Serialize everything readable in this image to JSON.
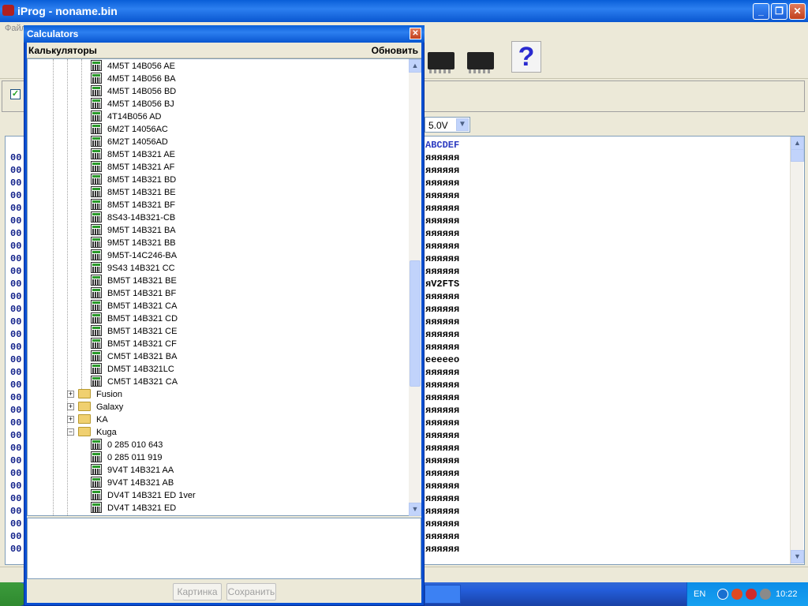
{
  "app": {
    "title": "iProg - noname.bin",
    "menu_first": "Файл",
    "voltage": "5.0V",
    "hex_header": "ABCDEF",
    "hex_addr_prefix": "00",
    "ascii_rows": [
      "яяяяяя",
      "яяяяяя",
      "яяяяяя",
      "яяяяяя",
      "яяяяяя",
      "яяяяяя",
      "яяяяяя",
      "яяяяяя",
      "яяяяяя",
      "яяяяяя",
      "яV2FTS",
      "яяяяяя",
      "яяяяяя",
      "яяяяяя",
      "яяяяяя",
      "яяяяяя",
      "eeeeeo",
      "яяяяяя",
      "яяяяяя",
      "яяяяяя",
      "яяяяяя",
      "яяяяяя",
      "яяяяяя",
      "яяяяяя",
      "яяяяяя",
      "яяяяяя",
      "яяяяяя",
      "яяяяяя",
      "яяяяяя",
      "яяяяяя",
      "яяяяяя",
      "яяяяяя"
    ]
  },
  "dialog": {
    "title": "Calculators",
    "header_left": "Калькуляторы",
    "header_right": "Обновить",
    "calc_items": [
      "4M5T 14B056 AE",
      "4M5T 14B056 BA",
      "4M5T 14B056 BD",
      "4M5T 14B056 BJ",
      "4T14B056 AD",
      "6M2T 14056AC",
      "6M2T 14056AD",
      "8M5T 14B321 AE",
      "8M5T 14B321 AF",
      "8M5T 14B321 BD",
      "8M5T 14B321 BE",
      "8M5T 14B321 BF",
      "8S43-14B321-CB",
      "9M5T 14B321 BA",
      "9M5T 14B321 BB",
      "9M5T-14C246-BA",
      "9S43 14B321 CC",
      "BM5T 14B321 BE",
      "BM5T 14B321 BF",
      "BM5T 14B321 CA",
      "BM5T 14B321 CD",
      "BM5T 14B321 CE",
      "BM5T 14B321 CF",
      "CM5T 14B321 BA",
      "DM5T 14B321LC",
      "CM5T 14B321 CA"
    ],
    "folders": [
      {
        "label": "Fusion",
        "expander": "+"
      },
      {
        "label": "Galaxy",
        "expander": "+"
      },
      {
        "label": "KA",
        "expander": "+"
      },
      {
        "label": "Kuga",
        "expander": "−"
      }
    ],
    "kuga_items": [
      "0 285 010 643",
      "0 285 011 919",
      "9V4T 14B321 AA",
      "9V4T 14B321 AB",
      "DV4T 14B321 ED 1ver",
      "DV4T 14B321 ED"
    ],
    "btn_picture": "Картинка",
    "btn_save": "Сохранить"
  },
  "taskbar": {
    "lang": "EN",
    "clock": "10:22"
  },
  "colors": {
    "titlebar": "#0a5fd8",
    "hex_text": "#10208a",
    "panel": "#ece9d8"
  }
}
